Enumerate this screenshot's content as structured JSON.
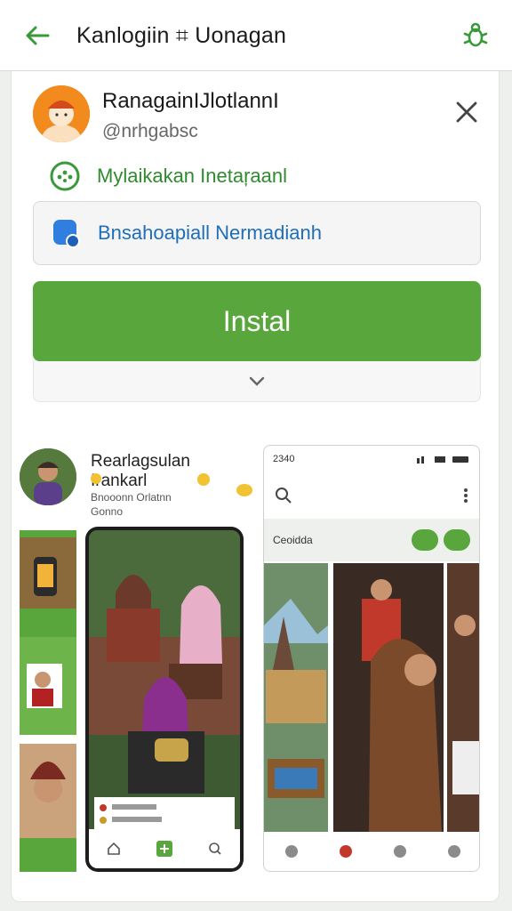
{
  "appbar": {
    "title": "Kanlogiin ⌗ Uonagan",
    "back_icon": "arrow-left-icon",
    "menu_icon": "bug-icon"
  },
  "user": {
    "name": "RanagainIJlotlannI",
    "handle": "@nrhgabsc"
  },
  "message": {
    "text": "Mylaikakan Inetaŗaanl"
  },
  "store": {
    "text": "Bnsahoapiall Nermadianh"
  },
  "install": {
    "label": "Instal"
  },
  "preview": {
    "app_title": "Rearlagsulan Irankarl",
    "sub1": "Bnooonn Orlatnn",
    "sub2": "Gonno"
  },
  "right_phone": {
    "time": "2340",
    "chip_label": "Ceoidda"
  },
  "colors": {
    "accent_green": "#58a63c",
    "link_blue": "#1f6fb8",
    "message_green": "#2e8b2e"
  }
}
